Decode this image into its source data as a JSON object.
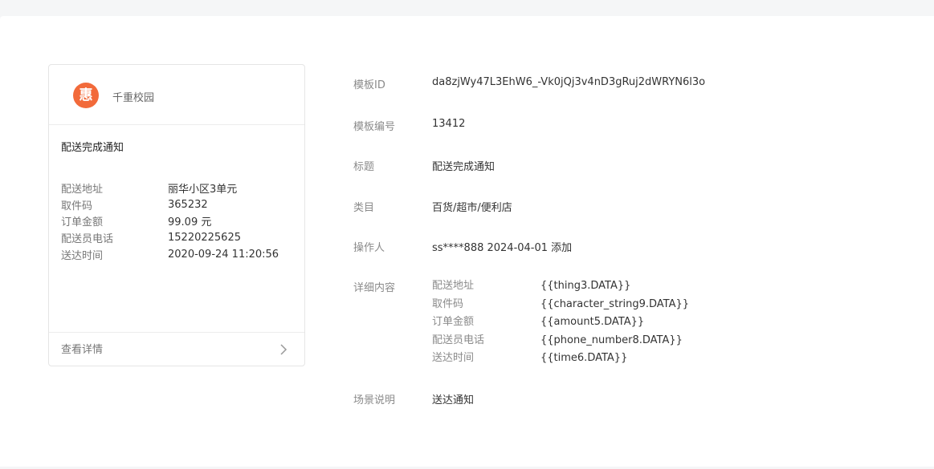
{
  "preview": {
    "brand_name": "千重校园",
    "logo_glyph": "惠",
    "logo_color": "#f26a3a",
    "title": "配送完成通知",
    "fields": [
      {
        "key": "配送地址",
        "value": "丽华小区3单元"
      },
      {
        "key": "取件码",
        "value": "365232"
      },
      {
        "key": "订单金额",
        "value": "99.09 元"
      },
      {
        "key": "配送员电话",
        "value": "15220225625"
      },
      {
        "key": "送达时间",
        "value": "2020-09-24 11:20:56"
      }
    ],
    "footer_label": "查看详情"
  },
  "details": {
    "template_id": {
      "label": "模板ID",
      "value": "da8zjWy47L3EhW6_-Vk0jQj3v4nD3gRuj2dWRYN6l3o"
    },
    "template_no": {
      "label": "模板编号",
      "value": "13412"
    },
    "title": {
      "label": "标题",
      "value": "配送完成通知"
    },
    "category": {
      "label": "类目",
      "value": "百货/超市/便利店"
    },
    "operator": {
      "label": "操作人",
      "value": "ss****888 2024-04-01 添加"
    },
    "content": {
      "label": "详细内容",
      "rows": [
        {
          "key": "配送地址",
          "value": "{{thing3.DATA}}"
        },
        {
          "key": "取件码",
          "value": "{{character_string9.DATA}}"
        },
        {
          "key": "订单金额",
          "value": "{{amount5.DATA}}"
        },
        {
          "key": "配送员电话",
          "value": "{{phone_number8.DATA}}"
        },
        {
          "key": "送达时间",
          "value": "{{time6.DATA}}"
        }
      ]
    },
    "scenario": {
      "label": "场景说明",
      "value": "送达通知"
    }
  }
}
